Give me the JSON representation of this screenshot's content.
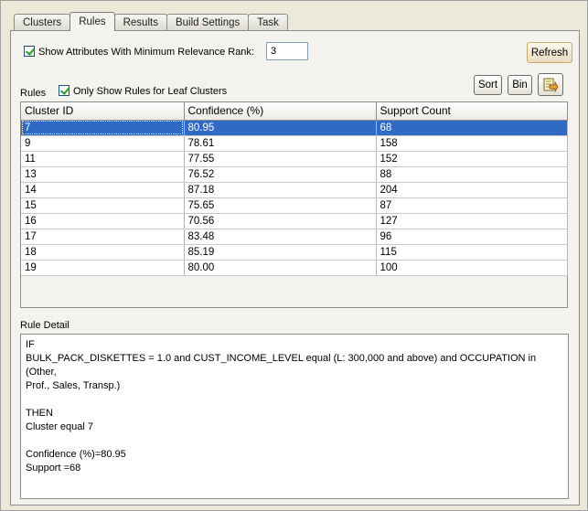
{
  "tabs": [
    {
      "label": "Clusters",
      "active": false
    },
    {
      "label": "Rules",
      "active": true
    },
    {
      "label": "Results",
      "active": false
    },
    {
      "label": "Build Settings",
      "active": false
    },
    {
      "label": "Task",
      "active": false
    }
  ],
  "controls": {
    "show_attributes_label": "Show Attributes With Minimum Relevance Rank:",
    "min_rank_value": "3",
    "refresh_label": "Refresh",
    "rules_label": "Rules",
    "leaf_only_label": "Only Show Rules for Leaf Clusters",
    "sort_label": "Sort",
    "bin_label": "Bin"
  },
  "table": {
    "columns": [
      "Cluster ID",
      "Confidence (%)",
      "Support Count"
    ],
    "rows": [
      [
        "7",
        "80.95",
        "68"
      ],
      [
        "9",
        "78.61",
        "158"
      ],
      [
        "11",
        "77.55",
        "152"
      ],
      [
        "13",
        "76.52",
        "88"
      ],
      [
        "14",
        "87.18",
        "204"
      ],
      [
        "15",
        "75.65",
        "87"
      ],
      [
        "16",
        "70.56",
        "127"
      ],
      [
        "17",
        "83.48",
        "96"
      ],
      [
        "18",
        "85.19",
        "115"
      ],
      [
        "19",
        "80.00",
        "100"
      ]
    ],
    "selected_index": 0
  },
  "detail": {
    "label": "Rule Detail",
    "lines": [
      "IF",
      "BULK_PACK_DISKETTES = 1.0 and CUST_INCOME_LEVEL equal (L: 300,000 and above) and OCCUPATION in (Other,",
      "Prof., Sales, Transp.)",
      "",
      "THEN",
      "Cluster equal 7",
      "",
      "Confidence (%)=80.95",
      "Support =68"
    ]
  },
  "icons": {
    "export": "export-icon",
    "checkbox": "checkmark-icon"
  },
  "colors": {
    "selection": "#316ac5",
    "background": "#ece9d8",
    "checkmark": "#21a121"
  }
}
